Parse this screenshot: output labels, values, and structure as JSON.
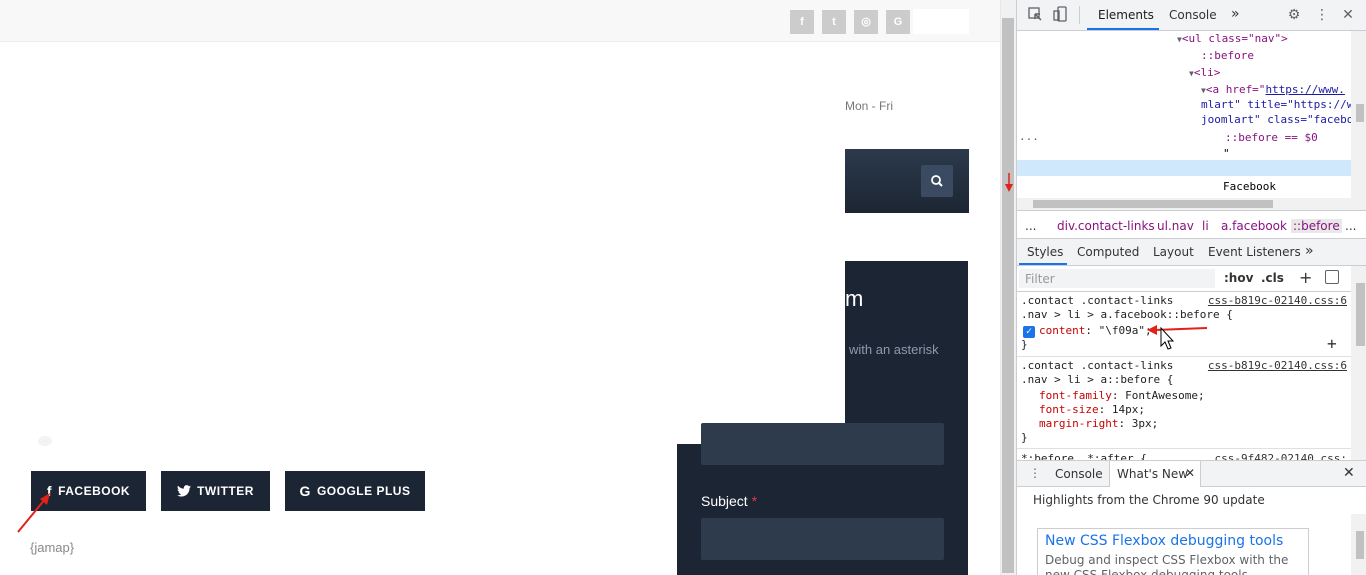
{
  "page": {
    "hours_text": "Mon - Fri",
    "form": {
      "heading_fragment": "m",
      "note_fragment": "with an asterisk",
      "subject_label": "Subject",
      "required_mark": "*"
    },
    "social_buttons": [
      {
        "icon": "facebook-icon",
        "glyph": "f",
        "label": "FACEBOOK"
      },
      {
        "icon": "twitter-icon",
        "glyph": "🐦",
        "label": "TWITTER"
      },
      {
        "icon": "google-icon",
        "glyph": "G",
        "label": "GOOGLE PLUS"
      }
    ],
    "topbar_icons": [
      {
        "name": "facebook-icon",
        "glyph": "f"
      },
      {
        "name": "twitter-icon",
        "glyph": "t"
      },
      {
        "name": "instagram-icon",
        "glyph": "◎"
      },
      {
        "name": "google-icon",
        "glyph": "G"
      }
    ],
    "jamap_text": "{jamap}"
  },
  "devtools": {
    "tabs": {
      "elements": "Elements",
      "console": "Console",
      "more": "»"
    },
    "dom": {
      "ul_open": "<ul class=\"nav\">",
      "before1": "::before",
      "li_open": "<li>",
      "a_line1_prefix": "<a href=\"",
      "a_href": "https://www.",
      "a_line2": "mlart\" title=\"https://w",
      "a_line3": "joomlart\" class=\"facebo",
      "selected": "::before == $0",
      "quote": "\"",
      "facebook_text": "Facebook",
      "ellipsis": "..."
    },
    "breadcrumbs": [
      "...",
      "div.contact-links",
      "ul.nav",
      "li",
      "a.facebook",
      "::before",
      "..."
    ],
    "styles_tabs": [
      "Styles",
      "Computed",
      "Layout",
      "Event Listeners",
      "»"
    ],
    "filter_placeholder": "Filter",
    "filter_tools": {
      "hov": ":hov",
      "cls": ".cls",
      "plus": "+"
    },
    "rules": {
      "r1_sel1": ".contact .contact-links",
      "r1_sel2": ".nav > li > a.facebook::before {",
      "r1_src": "css-b819c-02140.css:6",
      "r1_prop": "content",
      "r1_val": "\"\\f09a\";",
      "close": "}",
      "r2_sel1": ".contact .contact-links",
      "r2_sel2": ".nav > li > a::before {",
      "r2_src": "css-b819c-02140.css:6",
      "r2_p1": "font-family",
      "r2_v1": "FontAwesome;",
      "r2_p2": "font-size",
      "r2_v2": "14px;",
      "r2_p3": "margin-right",
      "r2_v3": "3px;",
      "r3_sel": "*:before, *:after {",
      "r3_src": "css-9f482-02140.css:"
    },
    "drawer": {
      "tab_console": "Console",
      "tab_whatsnew": "What's New",
      "highlights": "Highlights from the Chrome 90 update",
      "card_title": "New CSS Flexbox debugging tools",
      "card_body": "Debug and inspect CSS Flexbox with the new CSS Flexbox debugging tools"
    }
  },
  "colors": {
    "dark_navy": "#1c2533",
    "devtools_accent": "#1a73e8",
    "annotation_red": "#e0221b"
  }
}
